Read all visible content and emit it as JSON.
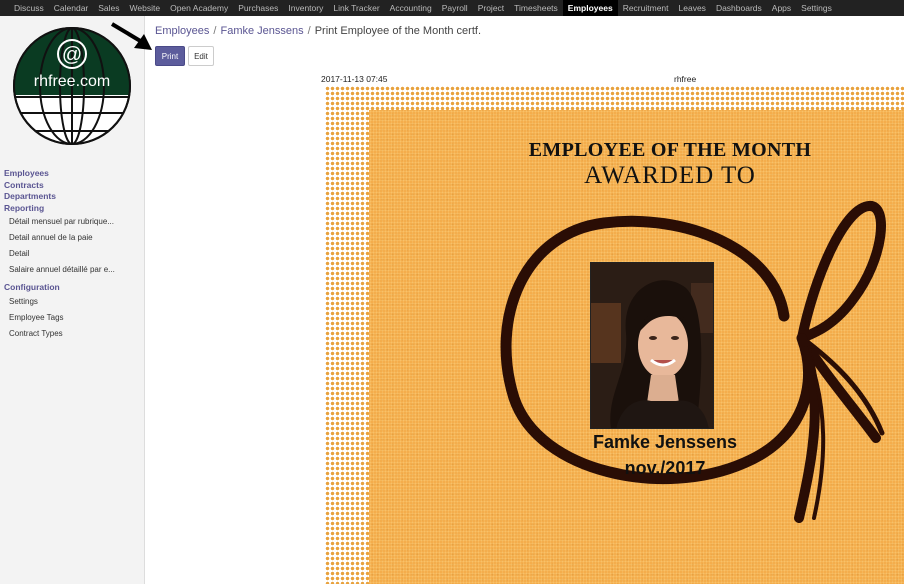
{
  "topnav": {
    "items": [
      "Discuss",
      "Calendar",
      "Sales",
      "Website",
      "Open Academy",
      "Purchases",
      "Inventory",
      "Link Tracker",
      "Accounting",
      "Payroll",
      "Project",
      "Timesheets",
      "Employees",
      "Recruitment",
      "Leaves",
      "Dashboards",
      "Apps",
      "Settings"
    ],
    "active": "Employees"
  },
  "logo": {
    "symbol": "@",
    "text": "rhfree.com",
    "color_top": "#0a3b22",
    "color_bottom": "#ffffff"
  },
  "sidebar": {
    "sections": [
      "Employees",
      "Contracts",
      "Departments",
      "Reporting"
    ],
    "reporting_items": [
      "Détail mensuel par rubrique...",
      "Detail annuel de la paie",
      "Detail",
      "Salaire annuel détaillé par e..."
    ],
    "configuration": "Configuration",
    "configuration_items": [
      "Settings",
      "Employee Tags",
      "Contract Types"
    ]
  },
  "breadcrumb": {
    "items": [
      "Employees",
      "Famke Jenssens"
    ],
    "current": "Print Employee of the Month certf.",
    "separator": "/"
  },
  "buttons": {
    "print": "Print",
    "edit": "Edit"
  },
  "report": {
    "timestamp": "2017-11-13 07:45",
    "company": "rhfree"
  },
  "certificate": {
    "title": "EMPLOYEE OF THE MONTH",
    "subtitle": "AWARDED TO",
    "name": "Famke Jenssens",
    "date": "nov./2017"
  },
  "colors": {
    "accent": "#5c5c9c",
    "nav_bg": "#222222",
    "certificate_bg": "#f4ad4c",
    "ribbon": "#2a0d05"
  }
}
